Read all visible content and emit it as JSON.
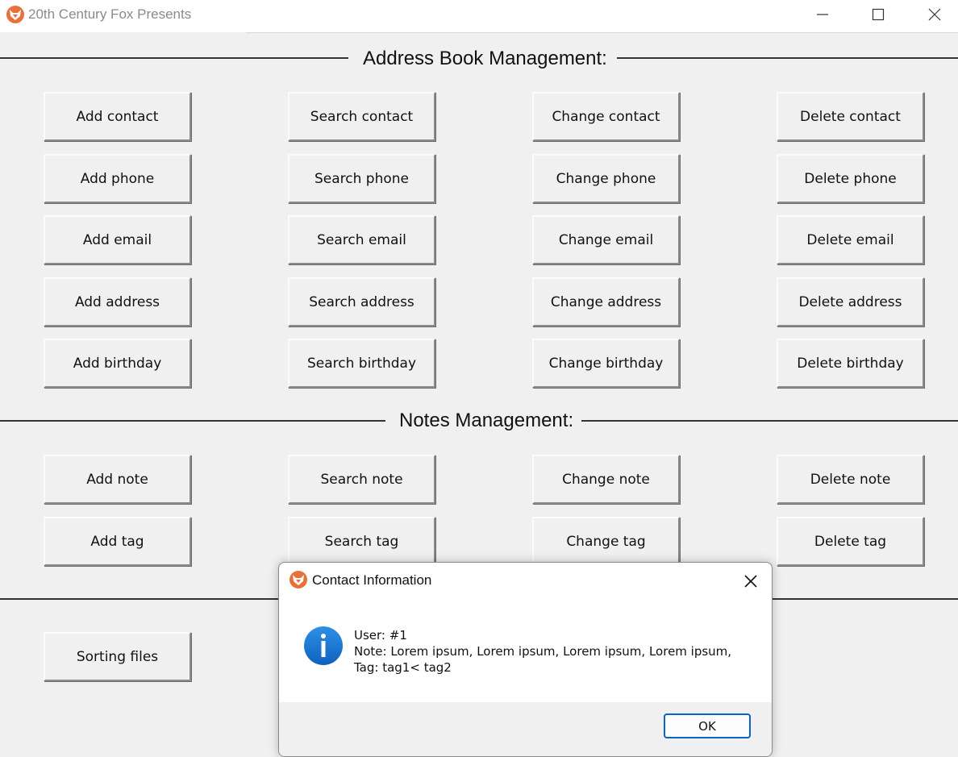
{
  "window": {
    "title": "20th Century Fox Presents",
    "controls": {
      "minimize_icon": "minimize-icon",
      "maximize_icon": "maximize-icon",
      "close_icon": "close-icon"
    }
  },
  "address_book": {
    "title": "Address Book Management:",
    "buttons": [
      [
        "Add contact",
        "Search contact",
        "Change contact",
        "Delete contact"
      ],
      [
        "Add phone",
        "Search phone",
        "Change phone",
        "Delete phone"
      ],
      [
        "Add email",
        "Search email",
        "Change email",
        "Delete email"
      ],
      [
        "Add address",
        "Search address",
        "Change address",
        "Delete address"
      ],
      [
        "Add birthday",
        "Search birthday",
        "Change birthday",
        "Delete birthday"
      ]
    ]
  },
  "notes": {
    "title": "Notes Management:",
    "buttons": [
      [
        "Add note",
        "Search note",
        "Change note",
        "Delete note"
      ],
      [
        "Add tag",
        "Search tag",
        "Change tag",
        "Delete tag"
      ]
    ]
  },
  "extra": {
    "sorting_label": "Sorting files"
  },
  "dialog": {
    "title": "Contact Information",
    "icon": "info-icon",
    "lines": [
      "User: #1",
      "Note: Lorem ipsum, Lorem ipsum, Lorem ipsum, Lorem ipsum,",
      "Tag: tag1< tag2"
    ],
    "ok_label": "OK"
  },
  "colors": {
    "accent": "#0a62c4",
    "info_blue": "#1a78d6",
    "fox_orange": "#e8703a"
  }
}
